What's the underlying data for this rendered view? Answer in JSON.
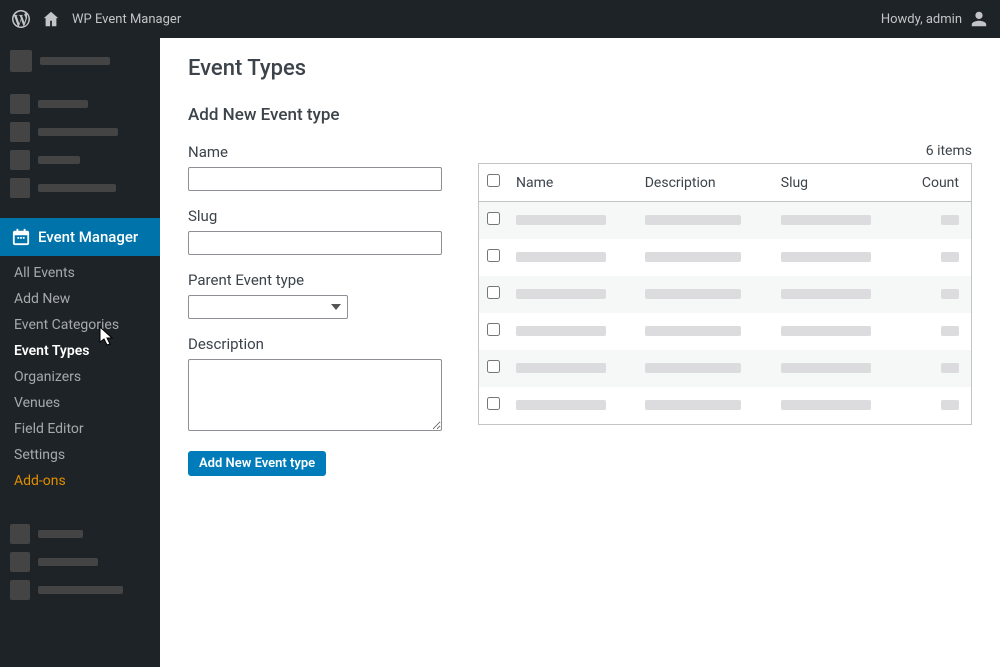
{
  "adminbar": {
    "site": "WP Event Manager",
    "howdy": "Howdy, admin"
  },
  "sidebar": {
    "parent": "Event Manager",
    "items": [
      "All Events",
      "Add New",
      "Event Categories",
      "Event Types",
      "Organizers",
      "Venues",
      "Field Editor",
      "Settings",
      "Add-ons"
    ]
  },
  "page": {
    "title": "Event Types",
    "form_title": "Add New Event type",
    "fields": {
      "name": "Name",
      "slug": "Slug",
      "parent": "Parent Event type",
      "description": "Description"
    },
    "submit": "Add New Event type"
  },
  "table": {
    "items_count": "6 items",
    "headers": {
      "name": "Name",
      "description": "Description",
      "slug": "Slug",
      "count": "Count"
    },
    "row_count": 6
  }
}
